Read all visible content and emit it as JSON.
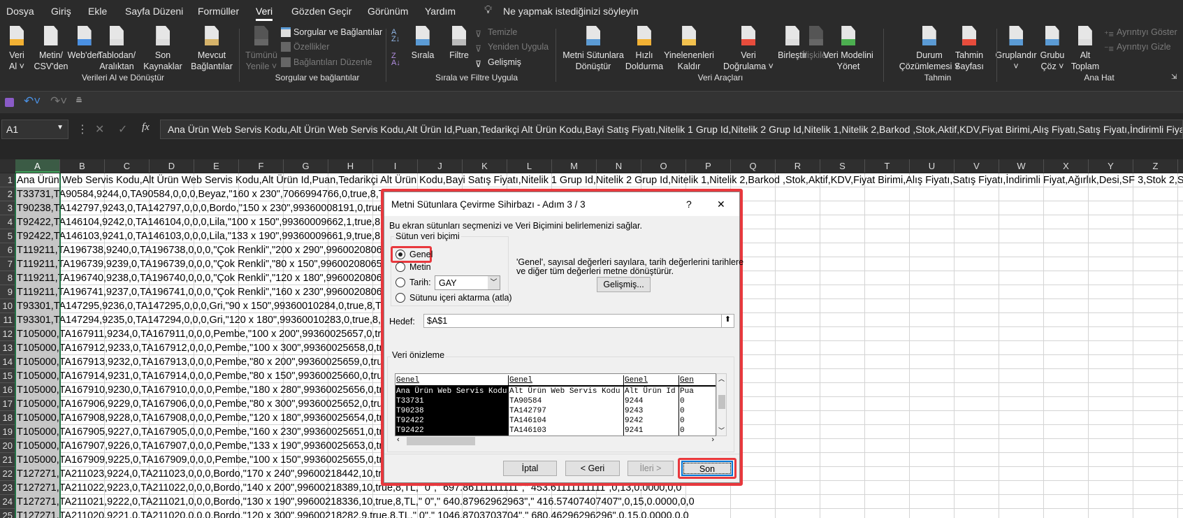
{
  "menu": {
    "tabs": [
      "Dosya",
      "Giriş",
      "Ekle",
      "Sayfa Düzeni",
      "Formüller",
      "Veri",
      "Gözden Geçir",
      "Görünüm",
      "Yardım"
    ],
    "active": "Veri",
    "tell_me": "Ne yapmak istediğinizi söyleyin"
  },
  "ribbon": {
    "buttons": [
      {
        "l1": "Veri",
        "l2": "Al ˅",
        "icon": "get-data-icon"
      },
      {
        "l1": "Metin/",
        "l2": "CSV'den",
        "icon": "text-csv-icon"
      },
      {
        "l1": "Web'den",
        "l2": "",
        "icon": "web-icon"
      },
      {
        "l1": "Tablodan/",
        "l2": "Aralıktan",
        "icon": "table-icon"
      },
      {
        "l1": "Son",
        "l2": "Kaynaklar",
        "icon": "recent-sources-icon"
      },
      {
        "l1": "Mevcut",
        "l2": "Bağlantılar",
        "icon": "existing-connections-icon"
      },
      {
        "l1": "Tümünü",
        "l2": "Yenile ˅",
        "icon": "refresh-all-icon",
        "disabled": true
      },
      {
        "l1": "Sırala",
        "l2": "",
        "icon": "sort-icon"
      },
      {
        "l1": "Filtre",
        "l2": "",
        "icon": "filter-icon"
      },
      {
        "l1": "Metni Sütunlara",
        "l2": "Dönüştür",
        "icon": "text-to-columns-icon"
      },
      {
        "l1": "Hızlı",
        "l2": "Doldurma",
        "icon": "flash-fill-icon"
      },
      {
        "l1": "Yinelenenleri",
        "l2": "Kaldır",
        "icon": "remove-duplicates-icon"
      },
      {
        "l1": "Veri",
        "l2": "Doğrulama ˅",
        "icon": "data-validation-icon"
      },
      {
        "l1": "Birleştir",
        "l2": "",
        "icon": "consolidate-icon"
      },
      {
        "l1": "İlişkiler",
        "l2": "",
        "icon": "relationships-icon",
        "disabled": true
      },
      {
        "l1": "Veri Modelini",
        "l2": "Yönet",
        "icon": "data-model-icon"
      },
      {
        "l1": "Durum",
        "l2": "Çözümlemesi ˅",
        "icon": "what-if-icon"
      },
      {
        "l1": "Tahmin",
        "l2": "Sayfası",
        "icon": "forecast-sheet-icon"
      },
      {
        "l1": "Gruplandır",
        "l2": "˅",
        "icon": "group-icon"
      },
      {
        "l1": "Grubu",
        "l2": "Çöz ˅",
        "icon": "ungroup-icon"
      },
      {
        "l1": "Alt",
        "l2": "Toplam",
        "icon": "subtotal-icon"
      }
    ],
    "small": {
      "queries": "Sorgular ve Bağlantılar",
      "properties": "Özellikler",
      "edit_links": "Bağlantıları Düzenle",
      "clear": "Temizle",
      "reapply": "Yeniden Uygula",
      "advanced": "Gelişmiş",
      "show_detail": "Ayrıntıyı Göster",
      "hide_detail": "Ayrıntıyı Gizle"
    },
    "groups": [
      "Verileri Al ve Dönüştür",
      "Sorgular ve bağlantılar",
      "Sırala ve Filtre Uygula",
      "Veri Araçları",
      "Tahmin",
      "Ana Hat"
    ]
  },
  "formula_bar": {
    "name_box": "A1",
    "fx": "fx",
    "value": "Ana Ürün Web Servis Kodu,Alt Ürün Web Servis Kodu,Alt Ürün Id,Puan,Tedarikçi Alt Ürün Kodu,Bayi Satış Fiyatı,Nitelik 1 Grup Id,Nitelik 2 Grup Id,Nitelik 1,Nitelik 2,Barkod ,Stok,Aktif,KDV,Fiyat Birimi,Alış Fiyatı,Satış Fiyatı,İndirimli Fiyat,Ağırlık,Desi,SF 3,Stok 2,Stok 3"
  },
  "sheet": {
    "columns": [
      "A",
      "B",
      "C",
      "D",
      "E",
      "F",
      "G",
      "H",
      "I",
      "J",
      "K",
      "L",
      "M",
      "N",
      "O",
      "P",
      "Q",
      "R",
      "S",
      "T",
      "U",
      "V",
      "W",
      "X",
      "Y",
      "Z"
    ],
    "selected_column": "A",
    "rows": [
      "Ana Ürün Web Servis Kodu,Alt Ürün Web Servis Kodu,Alt Ürün Id,Puan,Tedarikçi Alt Ürün Kodu,Bayi Satış Fiyatı,Nitelik 1 Grup Id,Nitelik 2 Grup Id,Nitelik 1,Nitelik 2,Barkod ,Stok,Aktif,KDV,Fiyat Birimi,Alış Fiyatı,Satış Fiyatı,İndirimli Fiyat,Ağırlık,Desi,SF 3,Stok 2,Stok 3",
      "T33731,TA90584,9244,0,TA90584,0,0,0,Beyaz,\"160 x 230\",7066994766,0,true,8,TL,\" 0\",\"",
      "T90238,TA142797,9243,0,TA142797,0,0,0,Bordo,\"150 x 230\",99360008191,0,true,8,TL,\" 0\"",
      "T92422,TA146104,9242,0,TA146104,0,0,0,Lila,\"100 x 150\",99360009662,1,true,8,TL,\" 0\",",
      "T92422,TA146103,9241,0,TA146103,0,0,0,Lila,\"133 x 190\",99360009661,9,true,8,TL,\" 0\",",
      "T119211,TA196738,9240,0,TA196738,0,0,0,\"Çok Renkli\",\"200 x 290\",99600208068,0,true",
      "T119211,TA196739,9239,0,TA196739,0,0,0,\"Çok Renkli\",\"80 x 150\",99600208065,0,true,",
      "T119211,TA196740,9238,0,TA196740,0,0,0,\"Çok Renkli\",\"120 x 180\",99600208066,0,true",
      "T119211,TA196741,9237,0,TA196741,0,0,0,\"Çok Renkli\",\"160 x 230\",99600208067,0,true",
      "T93301,TA147295,9236,0,TA147295,0,0,0,Gri,\"90 x 150\",99360010284,0,true,8,TL,\" 0\",\"",
      "T93301,TA147294,9235,0,TA147294,0,0,0,Gri,\"120 x 180\",99360010283,0,true,8,TL,\" 0\",",
      "T105000,TA167911,9234,0,TA167911,0,0,0,Pembe,\"100 x 200\",99360025657,0,true,8,TL,",
      "T105000,TA167912,9233,0,TA167912,0,0,0,Pembe,\"100 x 300\",99360025658,0,true,8,TL,",
      "T105000,TA167913,9232,0,TA167913,0,0,0,Pembe,\"80 x 200\",99360025659,0,true,8,TL,",
      "T105000,TA167914,9231,0,TA167914,0,0,0,Pembe,\"80 x 150\",99360025660,0,true,8,TL,",
      "T105000,TA167910,9230,0,TA167910,0,0,0,Pembe,\"180 x 280\",99360025656,0,true,8,TL,",
      "T105000,TA167906,9229,0,TA167906,0,0,0,Pembe,\"80 x 300\",99360025652,0,true,8,TL,",
      "T105000,TA167908,9228,0,TA167908,0,0,0,Pembe,\"120 x 180\",99360025654,0,true,8,TL,",
      "T105000,TA167905,9227,0,TA167905,0,0,0,Pembe,\"160 x 230\",99360025651,0,true,8,TL,",
      "T105000,TA167907,9226,0,TA167907,0,0,0,Pembe,\"133 x 190\",99360025653,0,true,8,TL,",
      "T105000,TA167909,9225,0,TA167909,0,0,0,Pembe,\"100 x 150\",99360025655,0,true,8,TL,",
      "T127271,TA211023,9224,0,TA211023,0,0,0,Bordo,\"170 x 240\",99600218442,10,true,8,TL,",
      "T127271,TA211022,9223,0,TA211022,0,0,0,Bordo,\"140 x 200\",99600218389,10,true,8,TL,\" 0\",\" 697.86111111111\",\" 453.61111111111\",0,13,0.0000,0,0",
      "T127271,TA211021,9222,0,TA211021,0,0,0,Bordo,\"130 x 190\",99600218336,10,true,8,TL,\" 0\",\" 640.87962962963\",\" 416.57407407407\",0,15,0.0000,0,0",
      "T127271,TA211020,9221,0,TA211020,0,0,0,Bordo,\"120 x 300\",99600218282,9,true,8,TL,\" 0\",\" 1046.8703703704\",\" 680.46296296296\",0,15,0.0000,0,0"
    ]
  },
  "dialog": {
    "title": "Metni Sütunlara Çevirme Sihirbazı - Adım 3 / 3",
    "help": "?",
    "close": "✕",
    "description": "Bu ekran sütunları seçmenizi ve Veri Biçimini belirlemenizi  sağlar.",
    "format_group": "Sütun veri biçimi",
    "options": {
      "general": "Genel",
      "text": "Metin",
      "date": "Tarih:",
      "skip": "Sütunu içeri aktarma (atla)"
    },
    "selected_option": "Genel",
    "date_format": "GAY",
    "info_line1": "'Genel', sayısal değerleri sayılara, tarih değerlerini tarihlere",
    "info_line2": "ve diğer tüm değerleri metne dönüştürür.",
    "advanced_btn": "Gelişmiş...",
    "dest_label": "Hedef:",
    "dest_value": "$A$1",
    "preview_label": "Veri önizleme",
    "preview": {
      "headers": [
        "Genel",
        "Genel",
        "Genel",
        "Gen"
      ],
      "rows": [
        [
          "Ana Ürün Web Servis Kodu",
          "Alt Ürün Web Servis Kodu",
          "Alt Ürün Id",
          "Pua"
        ],
        [
          "T33731",
          "TA90584",
          "9244",
          "0"
        ],
        [
          "T90238",
          "TA142797",
          "9243",
          "0"
        ],
        [
          "T92422",
          "TA146104",
          "9242",
          "0"
        ],
        [
          "T92422",
          "TA146103",
          "9241",
          "0"
        ]
      ]
    },
    "buttons": {
      "cancel": "İptal",
      "back": "< Geri",
      "next": "İleri >",
      "finish": "Son"
    },
    "highlight_color": "#e8383d"
  }
}
